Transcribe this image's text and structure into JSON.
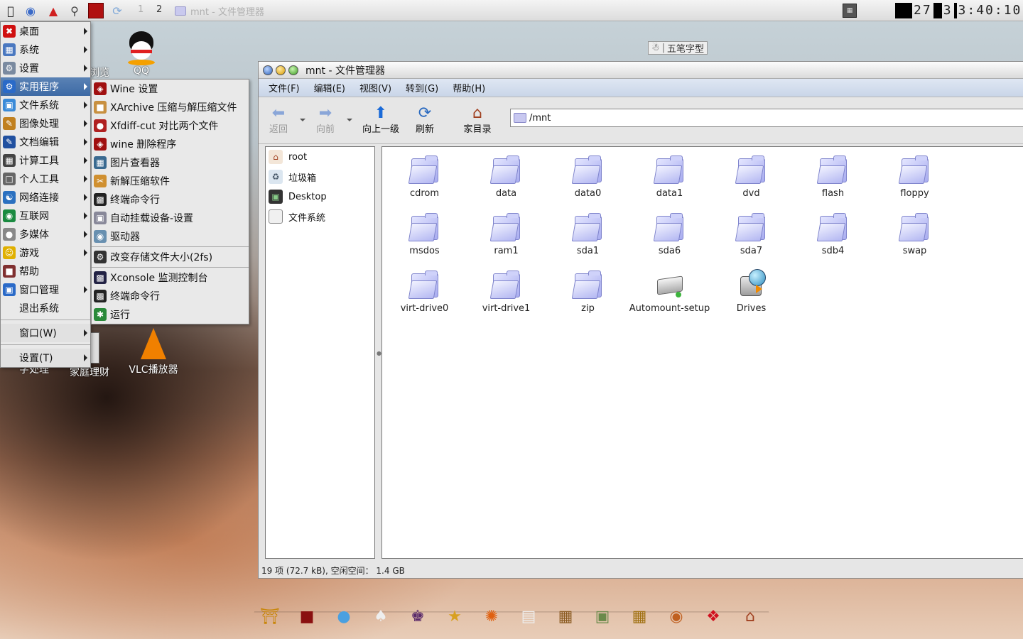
{
  "topbar": {
    "icons": [
      "apple-icon",
      "browser-icon",
      "alert-icon",
      "magnifier-icon",
      "app-icon",
      "refresh-icon"
    ],
    "workspaces": [
      "1",
      "2"
    ],
    "task_title": "mnt - 文件管理器",
    "clock": {
      "day": "27",
      "hour": "3",
      "time": "3:40:10"
    }
  },
  "desktop": {
    "icons": [
      {
        "label": "QQ"
      },
      {
        "label": "浏览"
      },
      {
        "label": "字处理"
      },
      {
        "label": "家庭理财"
      },
      {
        "label": "VLC播放器"
      }
    ],
    "ime_label": "五笔字型"
  },
  "start_menu": {
    "items": [
      {
        "label": "桌面",
        "submenu": true
      },
      {
        "label": "系统",
        "submenu": true
      },
      {
        "label": "设置",
        "submenu": true
      },
      {
        "label": "实用程序",
        "submenu": true,
        "selected": true
      },
      {
        "label": "文件系统",
        "submenu": true
      },
      {
        "label": "图像处理",
        "submenu": true
      },
      {
        "label": "文档编辑",
        "submenu": true
      },
      {
        "label": "计算工具",
        "submenu": true
      },
      {
        "label": "个人工具",
        "submenu": true
      },
      {
        "label": "网络连接",
        "submenu": true
      },
      {
        "label": "互联网",
        "submenu": true
      },
      {
        "label": "多媒体",
        "submenu": true
      },
      {
        "label": "游戏",
        "submenu": true
      },
      {
        "label": "帮助",
        "submenu": false
      },
      {
        "label": "窗口管理",
        "submenu": true
      },
      {
        "label": "退出系统",
        "submenu": false
      },
      {
        "label": "窗口(W)",
        "submenu": true
      },
      {
        "label": "设置(T)",
        "submenu": true
      }
    ]
  },
  "submenu": {
    "items": [
      {
        "label": "Wine 设置"
      },
      {
        "label": "XArchive 压缩与解压缩文件"
      },
      {
        "label": "Xfdiff-cut 对比两个文件"
      },
      {
        "label": "wine 删除程序"
      },
      {
        "label": "图片查看器"
      },
      {
        "label": "新解压缩软件"
      },
      {
        "label": "终端命令行"
      },
      {
        "label": "自动挂载设备-设置"
      },
      {
        "label": "驱动器"
      },
      {
        "label": "改变存储文件大小(2fs)"
      },
      {
        "label": "Xconsole 监测控制台"
      },
      {
        "label": "终端命令行"
      },
      {
        "label": "运行"
      }
    ]
  },
  "window": {
    "title": "mnt - 文件管理器",
    "menubar": [
      "文件(F)",
      "编辑(E)",
      "视图(V)",
      "转到(G)",
      "帮助(H)"
    ],
    "toolbar": {
      "back": "返回",
      "forward": "向前",
      "up": "向上一级",
      "refresh": "刷新",
      "home": "家目录"
    },
    "address": "/mnt",
    "sidebar": [
      {
        "label": "root",
        "icon": "home-folder-icon"
      },
      {
        "label": "垃圾箱",
        "icon": "trash-icon"
      },
      {
        "label": "Desktop",
        "icon": "desktop-icon"
      },
      {
        "label": "文件系统",
        "icon": "filesystem-icon"
      }
    ],
    "files": [
      {
        "name": "cdrom",
        "type": "folder"
      },
      {
        "name": "data",
        "type": "folder"
      },
      {
        "name": "data0",
        "type": "folder"
      },
      {
        "name": "data1",
        "type": "folder"
      },
      {
        "name": "dvd",
        "type": "folder"
      },
      {
        "name": "flash",
        "type": "folder"
      },
      {
        "name": "floppy",
        "type": "folder"
      },
      {
        "name": "msdos",
        "type": "folder"
      },
      {
        "name": "ram1",
        "type": "folder"
      },
      {
        "name": "sda1",
        "type": "folder"
      },
      {
        "name": "sda6",
        "type": "folder"
      },
      {
        "name": "sda7",
        "type": "folder"
      },
      {
        "name": "sdb4",
        "type": "folder"
      },
      {
        "name": "swap",
        "type": "folder"
      },
      {
        "name": "virt-drive0",
        "type": "folder"
      },
      {
        "name": "virt-drive1",
        "type": "folder"
      },
      {
        "name": "zip",
        "type": "folder"
      },
      {
        "name": "Automount-setup",
        "type": "drive"
      },
      {
        "name": "Drives",
        "type": "drives"
      }
    ],
    "status": "19 项 (72.7 kB), 空闲空间： 1.4 GB"
  },
  "dock": {
    "items": [
      "palace-icon",
      "book-icon",
      "orb-icon",
      "cards-icon",
      "chess-icon",
      "star-icon",
      "fire-icon",
      "notebook-icon",
      "abacus-icon",
      "picture-icon",
      "chest-icon",
      "drum-icon",
      "knot-icon",
      "house-icon"
    ]
  }
}
